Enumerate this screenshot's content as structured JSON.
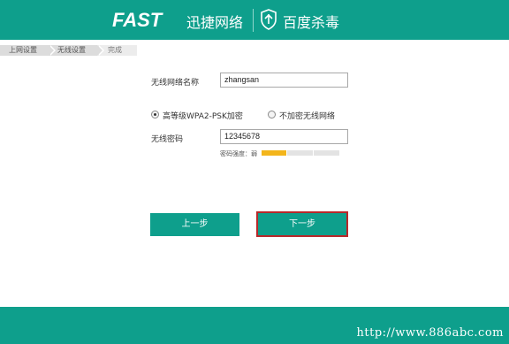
{
  "header": {
    "brand": "FAST",
    "brand_cn": "迅捷网络",
    "partner": "百度杀毒",
    "color": "#0e9f8c"
  },
  "breadcrumb": [
    "上网设置",
    "无线设置",
    "完成"
  ],
  "form": {
    "ssid_label": "无线网络名称",
    "ssid_value": "zhangsan",
    "security_option_1": "高等级WPA2-PSK加密",
    "security_option_2": "不加密无线网络",
    "security_selected": "高等级WPA2-PSK加密",
    "password_label": "无线密码",
    "password_value": "12345678",
    "strength_label": "密码强度：弱",
    "strength_level": 1,
    "strength_max": 3,
    "strength_color": "#f3b51b"
  },
  "buttons": {
    "prev": "上一步",
    "next": "下一步"
  },
  "watermark": "http://www.886abc.com"
}
